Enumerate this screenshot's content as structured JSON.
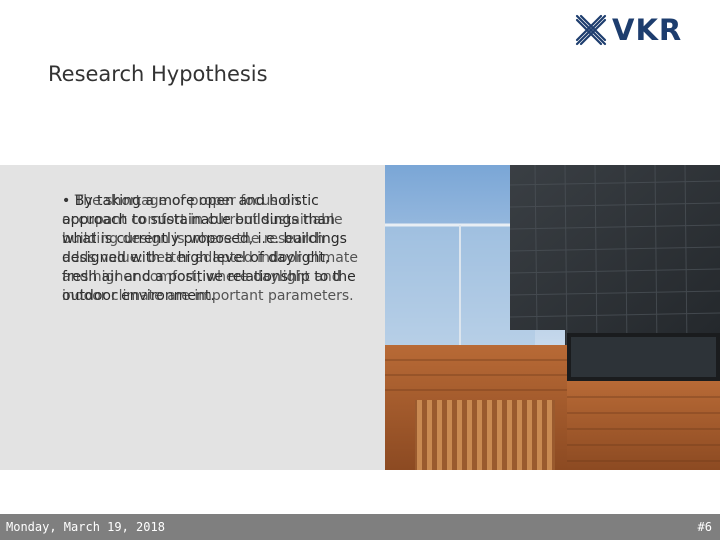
{
  "brand": {
    "logo_text": "VKR",
    "logo_color": "#1d3d6e"
  },
  "slide": {
    "title": "Research Hypothesis",
    "text_layer_1": "• By taking a more open and holistic approach to sustainable buildings than what is currently proposed, i.e. buildings designed with a high level of daylight, fresh air and a positive relationship to the outdoor environment.",
    "text_layer_2": "• The shortage of proper focus on occupant comfort in current sustainable building design is where the research adds value: better adapted indoor climate and higher comfort, where daylight and indoor climate are important parameters."
  },
  "footer": {
    "date": "Monday, March 19, 2018",
    "slide_number": "#6",
    "bg": "#7f7f7f"
  }
}
